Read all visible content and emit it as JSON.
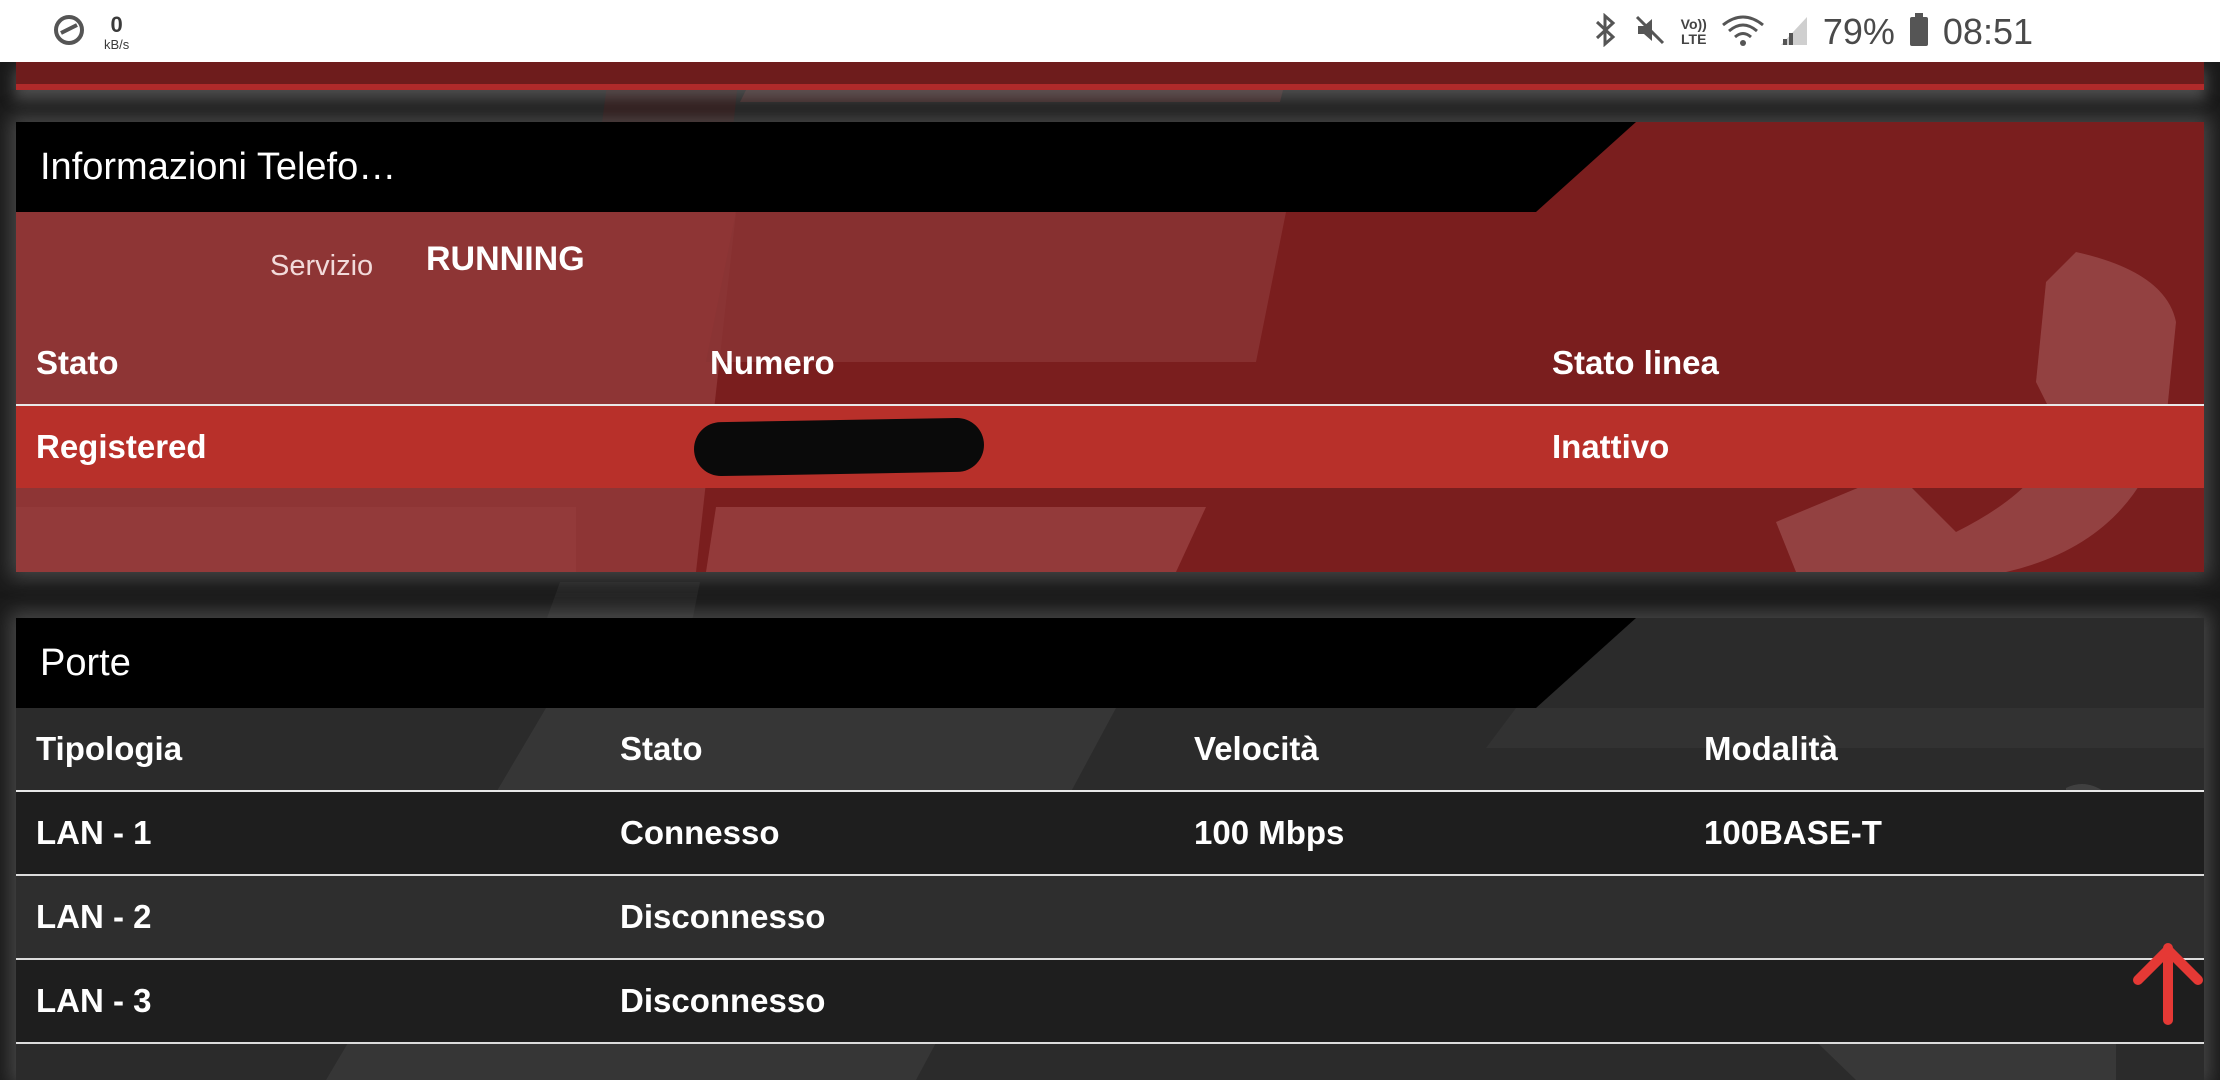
{
  "status_bar": {
    "net_speed_value": "0",
    "net_speed_unit": "kB/s",
    "volte_top": "Vo))",
    "volte_bottom": "LTE",
    "battery_percent": "79%",
    "time": "08:51"
  },
  "telephone_panel": {
    "title": "Informazioni Telefo…",
    "service_label": "Servizio",
    "service_value": "RUNNING",
    "columns": [
      "Stato",
      "Numero",
      "Stato linea"
    ],
    "row": {
      "stato": "Registered",
      "numero": "",
      "stato_linea": "Inattivo"
    }
  },
  "ports_panel": {
    "title": "Porte",
    "columns": [
      "Tipologia",
      "Stato",
      "Velocità",
      "Modalità"
    ],
    "rows": [
      {
        "tipologia": "LAN - 1",
        "stato": "Connesso",
        "velocita": "100 Mbps",
        "modalita": "100BASE-T"
      },
      {
        "tipologia": "LAN - 2",
        "stato": "Disconnesso",
        "velocita": "",
        "modalita": ""
      },
      {
        "tipologia": "LAN - 3",
        "stato": "Disconnesso",
        "velocita": "",
        "modalita": ""
      }
    ]
  },
  "colors": {
    "panel_red": "#7a1e1e",
    "row_red": "#b8302a",
    "panel_dark": "#2b2b2b",
    "scroll_arrow": "#e53935"
  },
  "icons": {
    "status_left": "data-saver-icon",
    "status_right": [
      "bluetooth-icon",
      "mute-icon",
      "volte-icon",
      "wifi-icon",
      "signal-icon",
      "battery-icon"
    ],
    "scroll": "arrow-up-icon"
  }
}
